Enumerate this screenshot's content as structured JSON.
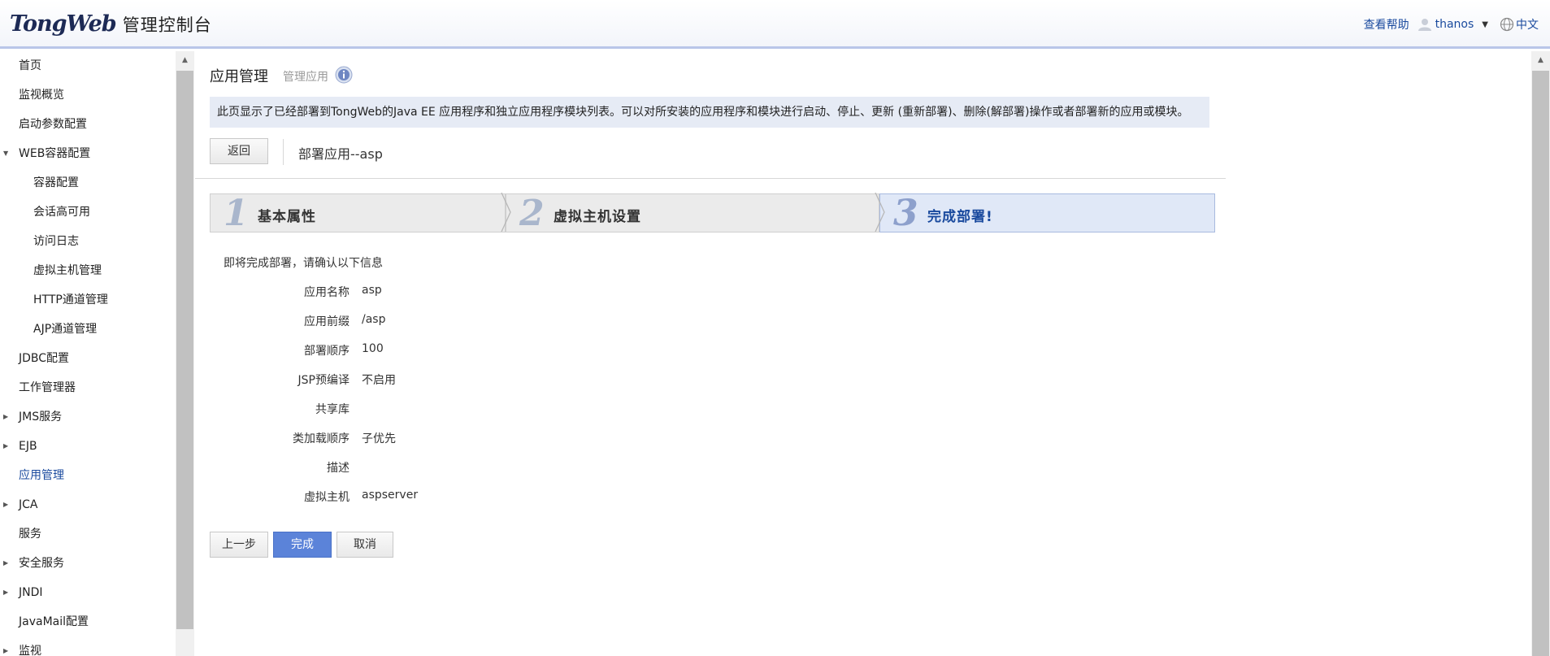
{
  "header": {
    "brand": "TongWeb",
    "title": "管理控制台",
    "help": "查看帮助",
    "user": "thanos",
    "language": "中文"
  },
  "sidebar": {
    "items": [
      {
        "label": "首页",
        "level": "top",
        "expandable": false
      },
      {
        "label": "监视概览",
        "level": "top",
        "expandable": false
      },
      {
        "label": "启动参数配置",
        "level": "top",
        "expandable": false
      },
      {
        "label": "WEB容器配置",
        "level": "top",
        "expandable": true,
        "expanded": true
      },
      {
        "label": "容器配置",
        "level": "sub",
        "expandable": false
      },
      {
        "label": "会话高可用",
        "level": "sub",
        "expandable": false
      },
      {
        "label": "访问日志",
        "level": "sub",
        "expandable": false
      },
      {
        "label": "虚拟主机管理",
        "level": "sub",
        "expandable": false
      },
      {
        "label": "HTTP通道管理",
        "level": "sub",
        "expandable": false
      },
      {
        "label": "AJP通道管理",
        "level": "sub",
        "expandable": false
      },
      {
        "label": "JDBC配置",
        "level": "top",
        "expandable": false
      },
      {
        "label": "工作管理器",
        "level": "top",
        "expandable": false
      },
      {
        "label": "JMS服务",
        "level": "top",
        "expandable": true
      },
      {
        "label": "EJB",
        "level": "top",
        "expandable": true
      },
      {
        "label": "应用管理",
        "level": "top",
        "expandable": false,
        "active": true
      },
      {
        "label": "JCA",
        "level": "top",
        "expandable": true
      },
      {
        "label": "服务",
        "level": "top",
        "expandable": false
      },
      {
        "label": "安全服务",
        "level": "top",
        "expandable": true
      },
      {
        "label": "JNDI",
        "level": "top",
        "expandable": true
      },
      {
        "label": "JavaMail配置",
        "level": "top",
        "expandable": false
      },
      {
        "label": "监视",
        "level": "top",
        "expandable": true
      }
    ]
  },
  "main": {
    "title": "应用管理",
    "subtitle": "管理应用",
    "description": "此页显示了已经部署到TongWeb的Java EE 应用程序和独立应用程序模块列表。可以对所安装的应用程序和模块进行启动、停止、更新 (重新部署)、删除(解部署)操作或者部署新的应用或模块。",
    "back_button": "返回",
    "breadcrumb": "部署应用--asp",
    "steps": [
      {
        "number": "1",
        "label": "基本属性"
      },
      {
        "number": "2",
        "label": "虚拟主机设置"
      },
      {
        "number": "3",
        "label": "完成部署!"
      }
    ],
    "confirm_intro": "即将完成部署，请确认以下信息",
    "fields": [
      {
        "label": "应用名称",
        "value": "asp"
      },
      {
        "label": "应用前缀",
        "value": "/asp"
      },
      {
        "label": "部署顺序",
        "value": "100"
      },
      {
        "label": "JSP预编译",
        "value": "不启用"
      },
      {
        "label": "共享库",
        "value": ""
      },
      {
        "label": "类加载顺序",
        "value": "子优先"
      },
      {
        "label": "描述",
        "value": ""
      },
      {
        "label": "虚拟主机",
        "value": "aspserver"
      }
    ],
    "prev_button": "上一步",
    "finish_button": "完成",
    "cancel_button": "取消"
  },
  "colors": {
    "accent": "#5b83d9",
    "link": "#1a4a9e",
    "desc_bg": "#e6ebf5",
    "active_step_bg": "#e0e8f7"
  }
}
